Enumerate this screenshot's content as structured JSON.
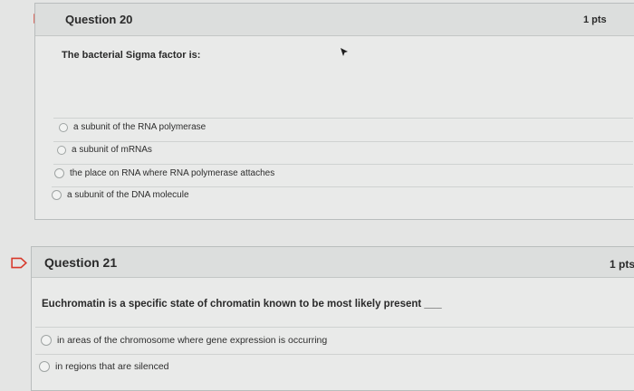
{
  "questions": [
    {
      "title": "Question 20",
      "points": "1 pts",
      "text": "The bacterial Sigma factor is:",
      "options": [
        "a subunit of the RNA polymerase",
        "a subunit of mRNAs",
        "the place on RNA where RNA polymerase attaches",
        "a subunit of the DNA molecule"
      ]
    },
    {
      "title": "Question 21",
      "points": "1 pts",
      "text": "Euchromatin is a specific state of chromatin known to be most likely present ___",
      "options": [
        "in areas of the chromosome where gene expression is occurring",
        "in regions that are silenced"
      ]
    }
  ],
  "colors": {
    "flag": "#d7392b",
    "border": "#b9bdbd",
    "header": "#dcdedd"
  },
  "icons": {
    "question_flag": "flag-icon",
    "pointer": "mouse-pointer-icon"
  }
}
